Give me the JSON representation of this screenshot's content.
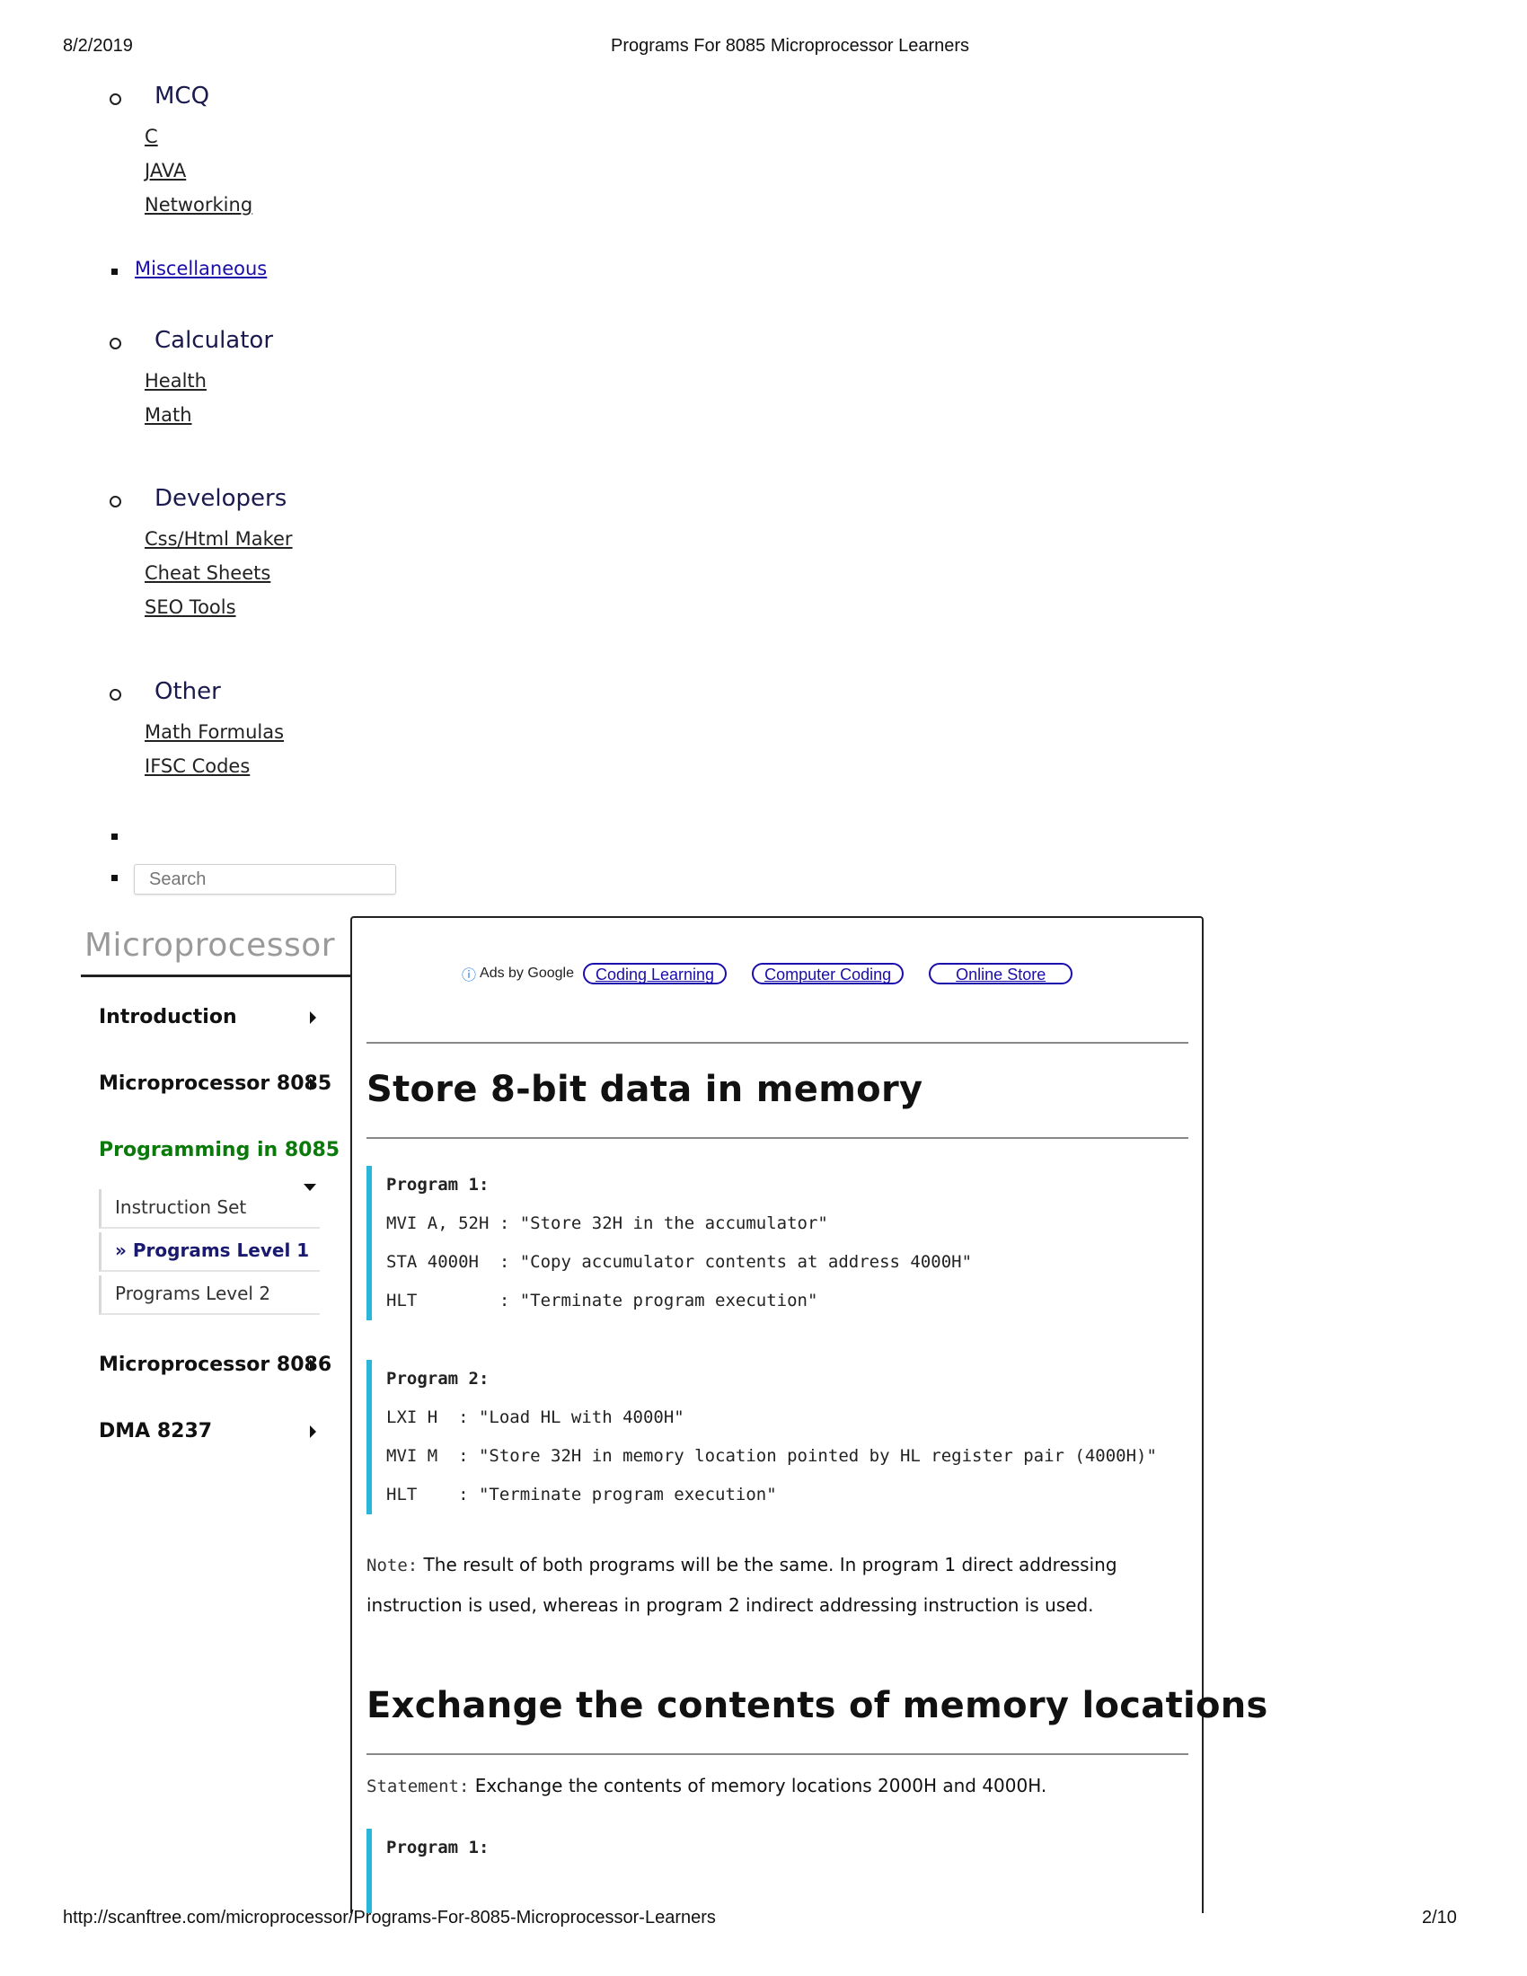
{
  "print_header": {
    "date": "8/2/2019",
    "title": "Programs For 8085 Microprocessor Learners"
  },
  "print_footer": {
    "url": "http://scanftree.com/microprocessor/Programs-For-8085-Microprocessor-Learners",
    "page": "2/10"
  },
  "nav": {
    "mcq": {
      "heading": "MCQ",
      "links": [
        "C",
        "JAVA",
        "Networking"
      ]
    },
    "misc": "Miscellaneous",
    "calculator": {
      "heading": "Calculator",
      "links": [
        "Health",
        "Math"
      ]
    },
    "developers": {
      "heading": "Developers",
      "links": [
        "Css/Html Maker",
        "Cheat Sheets",
        "SEO Tools"
      ]
    },
    "other": {
      "heading": "Other",
      "links": [
        "Math Formulas",
        "IFSC Codes"
      ]
    },
    "search_placeholder": "Search"
  },
  "sidebar": {
    "title": "Microprocessor",
    "items": [
      "Introduction",
      "Microprocessor 8085",
      "Programming in 8085",
      "Microprocessor 8086",
      "DMA 8237"
    ],
    "sub_items": [
      "Instruction Set",
      "» Programs Level 1",
      "Programs Level 2"
    ]
  },
  "ads": {
    "label": "Ads by Google",
    "buttons": [
      "Coding Learning",
      "Computer Coding",
      "Online Store"
    ]
  },
  "content": {
    "section1_title": "Store 8-bit data in memory",
    "program1": {
      "title": "Program 1:",
      "lines": [
        "MVI A, 52H : \"Store 32H in the accumulator\"",
        "STA 4000H  : \"Copy accumulator contents at address 4000H\"",
        "HLT        : \"Terminate program execution\""
      ]
    },
    "program2": {
      "title": "Program 2:",
      "lines": [
        "LXI H  : \"Load HL with 4000H\"",
        "MVI M  : \"Store 32H in memory location pointed by HL register pair (4000H)\"",
        "HLT    : \"Terminate program execution\""
      ]
    },
    "note_label": "Note:",
    "note_text": " The result of both programs will be the same. In program 1 direct addressing instruction is used, whereas in program 2 indirect addressing instruction is used.",
    "section2_title": "Exchange the contents of memory locations",
    "statement_label": "Statement:",
    "statement_text": " Exchange the contents of memory locations 2000H and 4000H.",
    "program3_title": "Program 1:"
  }
}
